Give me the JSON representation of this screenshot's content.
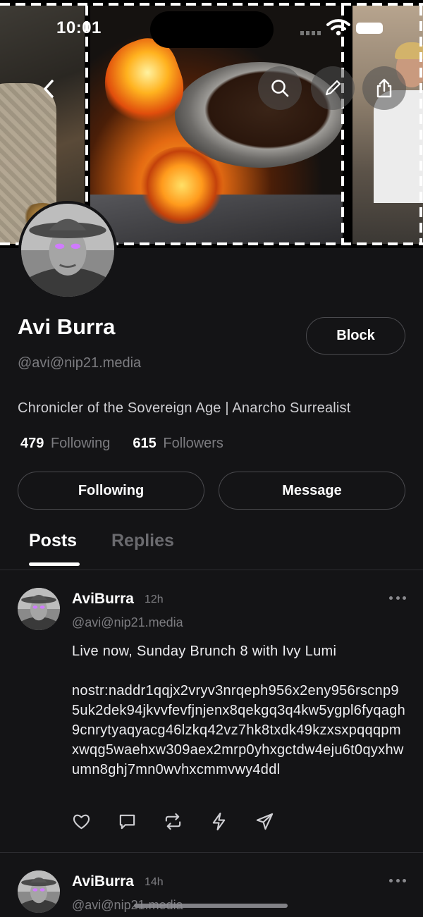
{
  "status_bar": {
    "time": "10:01"
  },
  "banner": {
    "tiles": [
      "portrait-tile",
      "cooking-fire-tile",
      "street-tile"
    ]
  },
  "profile": {
    "display_name": "Avi Burra",
    "handle": "@avi@nip21.media",
    "bio": "Chronicler of the Sovereign Age | Anarcho Surrealist",
    "following_count": "479",
    "following_label": "Following",
    "followers_count": "615",
    "followers_label": "Followers",
    "block_label": "Block",
    "following_button_label": "Following",
    "message_button_label": "Message"
  },
  "tabs": [
    {
      "label": "Posts",
      "active": true
    },
    {
      "label": "Replies",
      "active": false
    }
  ],
  "posts": [
    {
      "author": "AviBurra",
      "time": "12h",
      "handle": "@avi@nip21.media",
      "text_line1": "Live now, Sunday Brunch 8 with Ivy Lumi",
      "text_link": "nostr:naddr1qqjx2vryv3nrqeph956x2eny956rscnp95uk2dek94jkvvfevfjnjenx8qekgq3q4kw5ygpl6fyqagh9cnrytyaqyacg46lzkq42vz7hk8txdk49kzxsxpqqqpmxwqg5waehxw309aex2mrp0yhxgctdw4eju6t0qyxhwumn8ghj7mn0wvhxcmmvwy4ddl",
      "actions": [
        "heart-icon",
        "comment-icon",
        "repost-icon",
        "zap-icon",
        "share-send-icon"
      ]
    },
    {
      "author": "AviBurra",
      "time": "14h",
      "handle": "@avi@nip21.media"
    }
  ],
  "colors": {
    "background": "#141416",
    "muted_text": "#7c7c80",
    "border": "#4a4a4e"
  }
}
